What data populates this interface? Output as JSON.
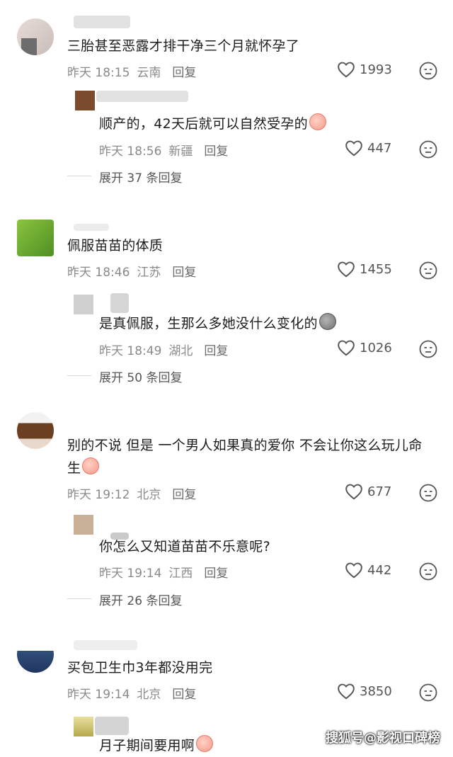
{
  "comments": [
    {
      "text": "三胎甚至恶露才排干净三个月就怀孕了",
      "time": "昨天 18:15",
      "location": "云南",
      "reply_label": "回复",
      "likes": "1993",
      "replies": [
        {
          "text": "顺产的，42天后就可以自然受孕的",
          "time": "昨天 18:56",
          "location": "新疆",
          "reply_label": "回复",
          "likes": "447"
        }
      ],
      "expand_label": "展开 37 条回复"
    },
    {
      "text": "佩服苗苗的体质",
      "time": "昨天 18:46",
      "location": "江苏",
      "reply_label": "回复",
      "likes": "1455",
      "replies": [
        {
          "text": "是真佩服，生那么多她没什么变化的",
          "time": "昨天 18:49",
          "location": "湖北",
          "reply_label": "回复",
          "likes": "1026"
        }
      ],
      "expand_label": "展开 50 条回复"
    },
    {
      "text_line1": "别的不说 但是 一个男人如果真的爱你 不会让你这么玩儿命",
      "text_line2": "生",
      "time": "昨天 19:12",
      "location": "北京",
      "reply_label": "回复",
      "likes": "677",
      "replies": [
        {
          "text": "你怎么又知道苗苗不乐意呢?",
          "time": "昨天 19:14",
          "location": "江西",
          "reply_label": "回复",
          "likes": "442"
        }
      ],
      "expand_label": "展开 26 条回复"
    },
    {
      "text": "买包卫生巾3年都没用完",
      "time": "昨天 19:14",
      "location": "北京",
      "reply_label": "回复",
      "likes": "3850",
      "replies": [
        {
          "text": "月子期间要用啊"
        }
      ]
    }
  ],
  "watermark": "搜狐号@影视口碑榜",
  "icons": {
    "like": "heart-outline-icon",
    "dislike": "neutral-face-icon"
  },
  "colors": {
    "text": "#1c1c1c",
    "meta": "#8a8a8a",
    "icon": "#555555"
  }
}
